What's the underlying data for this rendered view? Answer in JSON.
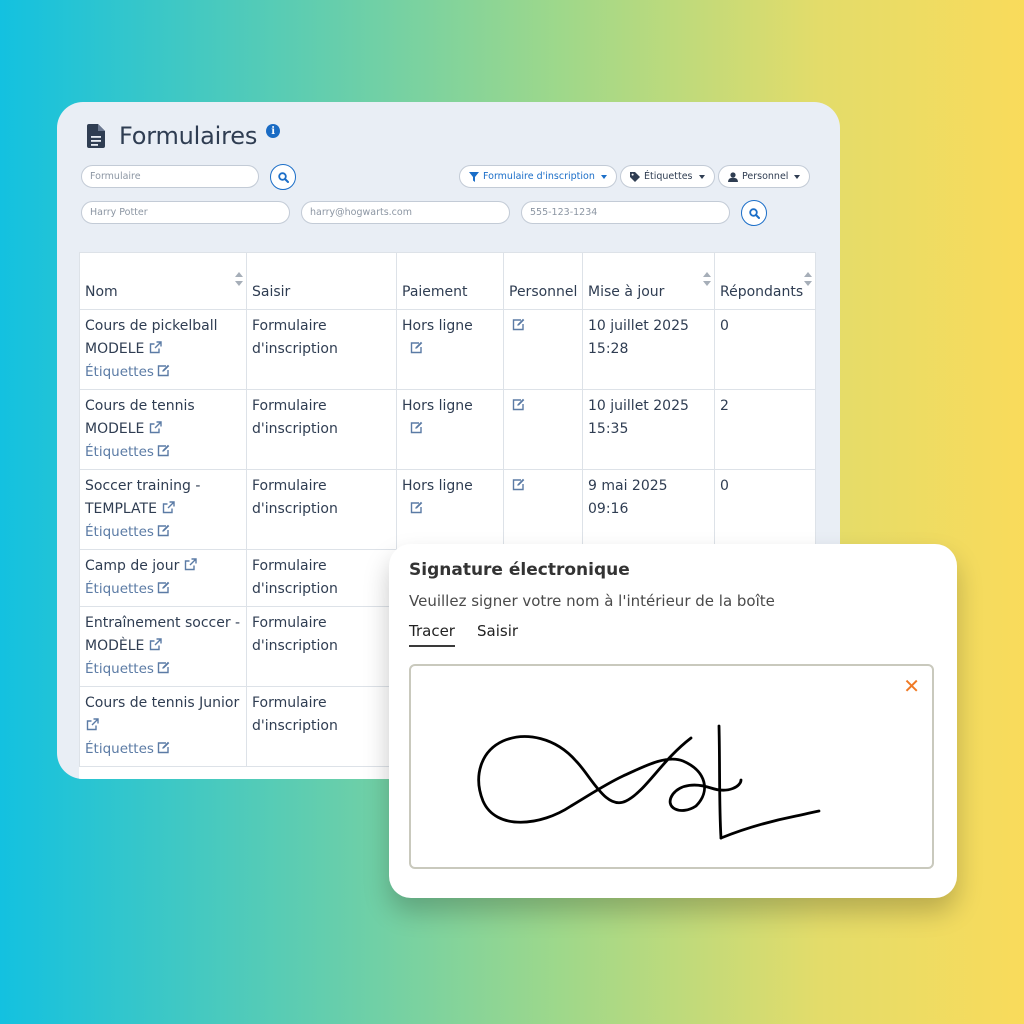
{
  "header": {
    "title": "Formulaires"
  },
  "filters": {
    "form_placeholder": "Formulaire",
    "type_filter": "Formulaire d'inscription",
    "tags_filter": "Étiquettes",
    "staff_filter": "Personnel",
    "name_placeholder": "Harry Potter",
    "email_placeholder": "harry@hogwarts.com",
    "phone_placeholder": "555-123-1234"
  },
  "table": {
    "columns": [
      "Nom",
      "Saisir",
      "Paiement",
      "Personnel",
      "Mise à jour",
      "Répondants"
    ],
    "tags_label": "Étiquettes",
    "rows": [
      {
        "name_line1": "Cours de pickelball",
        "name_line2": "MODELE",
        "saisir": "Formulaire d'inscription",
        "paiement": "Hors ligne",
        "updated": "10 juillet 2025 15:28",
        "respondents": "0"
      },
      {
        "name_line1": "Cours de tennis",
        "name_line2": "MODELE",
        "saisir": "Formulaire d'inscription",
        "paiement": "Hors ligne",
        "updated": "10 juillet 2025 15:35",
        "respondents": "2"
      },
      {
        "name_line1": "Soccer training -",
        "name_line2": "TEMPLATE",
        "saisir": "Formulaire d'inscription",
        "paiement": "Hors ligne",
        "updated": "9 mai 2025 09:16",
        "respondents": "0"
      },
      {
        "name_line1": "Camp de jour",
        "name_line2": "",
        "saisir": "Formulaire d'inscription",
        "paiement": "",
        "updated": "",
        "respondents": ""
      },
      {
        "name_line1": "Entraînement soccer -",
        "name_line2": "MODÈLE",
        "saisir": "Formulaire d'inscription",
        "paiement": "",
        "updated": "",
        "respondents": ""
      },
      {
        "name_line1": "Cours de tennis Junior",
        "name_line2": "",
        "saisir": "Formulaire d'inscription",
        "paiement": "",
        "updated": "",
        "respondents": ""
      }
    ]
  },
  "signature": {
    "title": "Signature électronique",
    "subtitle": "Veuillez signer votre nom à l'intérieur de la boîte",
    "tabs": [
      "Tracer",
      "Saisir"
    ],
    "close_symbol": "✕"
  },
  "colors": {
    "accent": "#1b6ec8",
    "close": "#f07a25",
    "text": "#2f3d52"
  }
}
